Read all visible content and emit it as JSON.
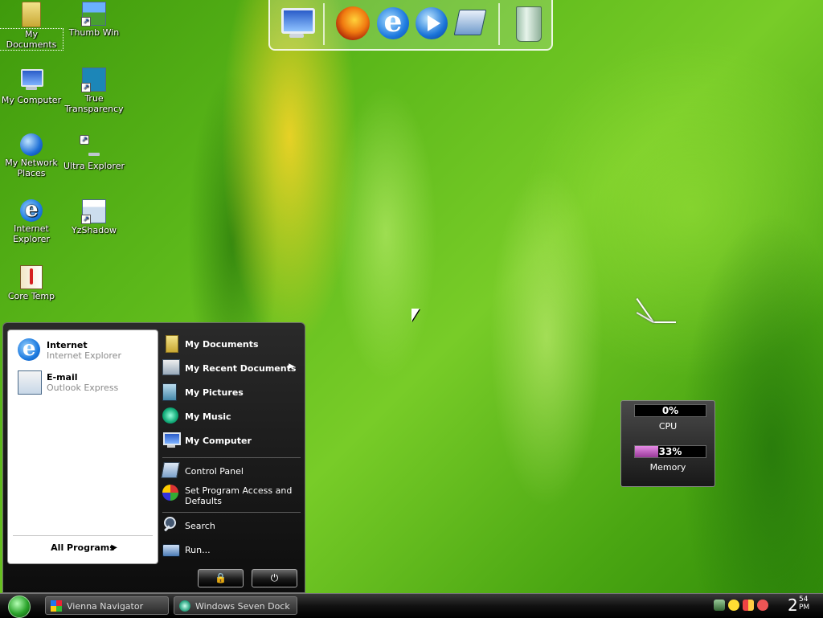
{
  "desktop": {
    "icons": [
      {
        "label": "My Documents",
        "icon": "folder-icon"
      },
      {
        "label": "Thumb Win",
        "icon": "thumb-win-icon"
      },
      {
        "label": "My Computer",
        "icon": "computer-icon"
      },
      {
        "label": "True Transparency",
        "icon": "true-transparency-icon"
      },
      {
        "label": "My Network Places",
        "icon": "network-icon"
      },
      {
        "label": "Ultra Explorer",
        "icon": "ultra-explorer-icon"
      },
      {
        "label": "Internet Explorer",
        "icon": "ie-icon"
      },
      {
        "label": "YzShadow",
        "icon": "yzshadow-icon"
      },
      {
        "label": "Core Temp",
        "icon": "core-temp-icon"
      }
    ]
  },
  "dock": {
    "items": [
      "computer-icon",
      "firefox-icon",
      "ie-icon",
      "media-player-icon",
      "control-panel-icon",
      "recycle-bin-icon"
    ]
  },
  "start_menu": {
    "pinned": [
      {
        "title": "Internet",
        "subtitle": "Internet Explorer",
        "icon": "ie-icon"
      },
      {
        "title": "E-mail",
        "subtitle": "Outlook Express",
        "icon": "outlook-icon"
      }
    ],
    "all_programs": "All Programs",
    "right": [
      {
        "label": "My Documents",
        "bold": true
      },
      {
        "label": "My Recent Documents",
        "bold": true,
        "submenu": true
      },
      {
        "label": "My Pictures",
        "bold": true
      },
      {
        "label": "My Music",
        "bold": true
      },
      {
        "label": "My Computer",
        "bold": true
      },
      {
        "label": "Control Panel",
        "bold": false
      },
      {
        "label": "Set Program Access and Defaults",
        "bold": false
      },
      {
        "label": "Search",
        "bold": false
      },
      {
        "label": "Run...",
        "bold": false
      }
    ],
    "lock_label": "🔒",
    "power_label": "⏻"
  },
  "taskbar": {
    "tasks": [
      "Vienna Navigator",
      "Windows Seven Dock"
    ],
    "clock_hour": "2",
    "clock_minute": "54",
    "clock_ampm": "PM"
  },
  "meter": {
    "cpu_value": "0%",
    "cpu_label": "CPU",
    "cpu_fraction": 0,
    "memory_value": "33%",
    "memory_label": "Memory",
    "memory_fraction": 0.33
  },
  "colors": {
    "accent_memory": "#b45ab4"
  }
}
